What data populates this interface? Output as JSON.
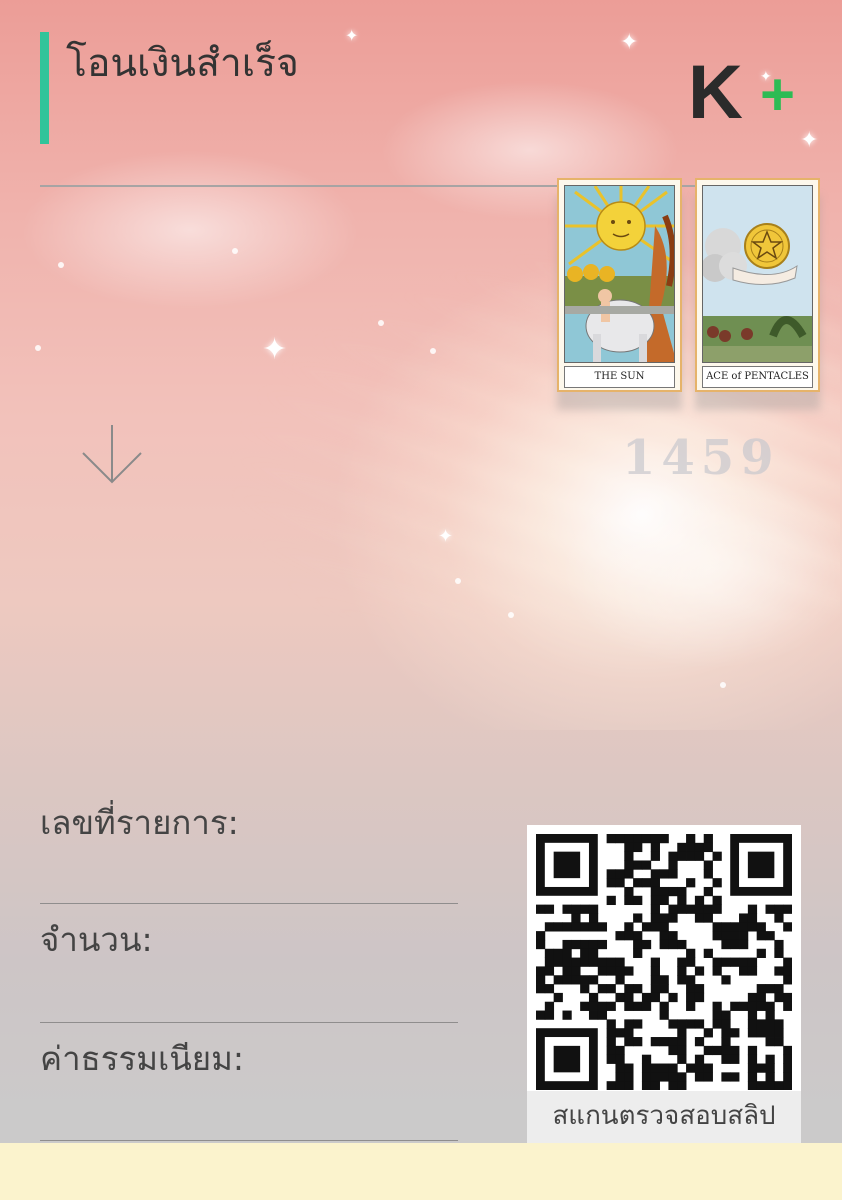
{
  "header": {
    "title": "โอนเงินสำเร็จ",
    "logo_letter": "K",
    "logo_plus": "+"
  },
  "cards": [
    {
      "caption": "THE SUN"
    },
    {
      "caption": "ACE of PENTACLES"
    }
  ],
  "lucky_number": "1459",
  "fields": {
    "transaction_label": "เลขที่รายการ:",
    "amount_label": "จำนวน:",
    "fee_label": "ค่าธรรมเนียม:"
  },
  "qr": {
    "caption": "สแกนตรวจสอบสลิป"
  },
  "colors": {
    "accent": "#31c49a",
    "logo_green": "#2dbb54",
    "footer": "#fbf3cd"
  },
  "icons": {
    "arrow": "arrow-down-icon",
    "qr": "qr-code-icon"
  }
}
